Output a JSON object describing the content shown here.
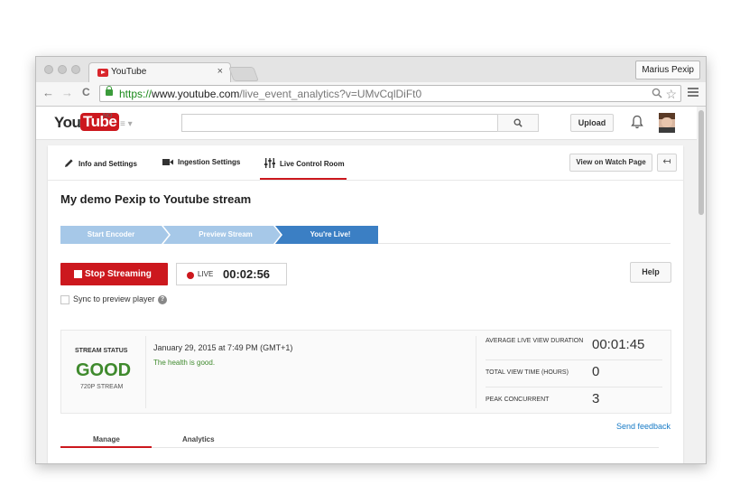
{
  "browser": {
    "tab_title": "YouTube",
    "tab_close": "×",
    "profile_name": "Marius Pexip",
    "url_scheme": "https://",
    "url_host": "www.youtube.com",
    "url_path": "/live_event_analytics?v=UMvCqlDiFt0",
    "back": "←",
    "forward": "→",
    "reload": "C",
    "star": "☆"
  },
  "youtube": {
    "logo_you": "You",
    "logo_tube": "Tube",
    "logo_region": "NO",
    "guide": "≡ ▾",
    "search_placeholder": "",
    "upload_label": "Upload"
  },
  "tabs": {
    "info": "Info and Settings",
    "ingestion": "Ingestion Settings",
    "control_room": "Live Control Room",
    "active": "Live Control Room",
    "view_watch_page": "View on Watch Page",
    "back_icon": "↤"
  },
  "stream": {
    "title": "My demo Pexip to Youtube stream",
    "steps": [
      "Start Encoder",
      "Preview Stream",
      "You're Live!"
    ],
    "stop_label": "Stop Streaming",
    "live_label": "LIVE",
    "live_time": "00:02:56",
    "help_label": "Help",
    "sync_label": "Sync to preview player",
    "sync_help": "?",
    "sync_checked": false
  },
  "status": {
    "label": "STREAM STATUS",
    "value": "GOOD",
    "resolution": "720P STREAM",
    "date": "January 29, 2015 at 7:49 PM (GMT+1)",
    "health": "The health is good.",
    "metrics": [
      {
        "label": "AVERAGE LIVE VIEW DURATION",
        "value": "00:01:45"
      },
      {
        "label": "TOTAL VIEW TIME (HOURS)",
        "value": "0"
      },
      {
        "label": "PEAK CONCURRENT",
        "value": "3"
      }
    ]
  },
  "footer": {
    "send_feedback": "Send feedback",
    "manage_tab": "Manage",
    "analytics_tab": "Analytics"
  },
  "colors": {
    "brand_red": "#cc181e",
    "good_green": "#3f8a2d",
    "step_light": "#a6c8e8",
    "step_active": "#3b7fc4",
    "link_blue": "#167ac6"
  }
}
